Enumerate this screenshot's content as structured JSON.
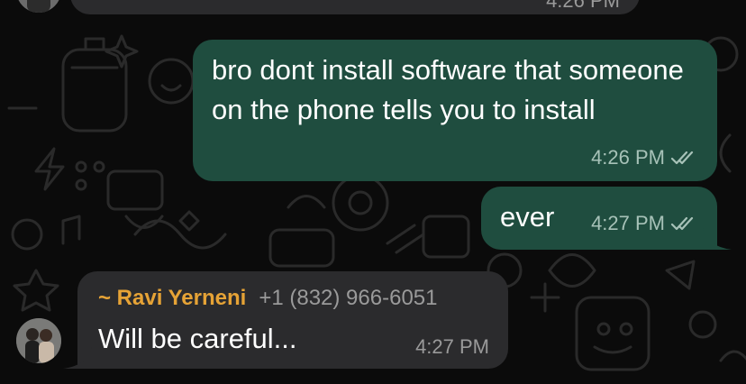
{
  "chat": {
    "previous_message": {
      "time": "4:26 PM"
    },
    "messages": [
      {
        "direction": "outgoing",
        "text": "bro dont install software that someone on the phone tells you to install",
        "time": "4:26 PM",
        "status": "read-double-check-icon"
      },
      {
        "direction": "outgoing",
        "text": "ever",
        "time": "4:27 PM",
        "status": "read-double-check-icon"
      },
      {
        "direction": "incoming",
        "sender_name": "~ Ravi Yerneni",
        "sender_phone": "+1 (832) 966-6051",
        "text": "Will be careful...",
        "time": "4:27 PM"
      }
    ]
  },
  "colors": {
    "background": "#0b0b0b",
    "outgoing_bubble": "#1f4d3f",
    "incoming_bubble": "#2b2b2d",
    "sender_name": "#e6a336",
    "meta_text": "#9a9a9a"
  }
}
